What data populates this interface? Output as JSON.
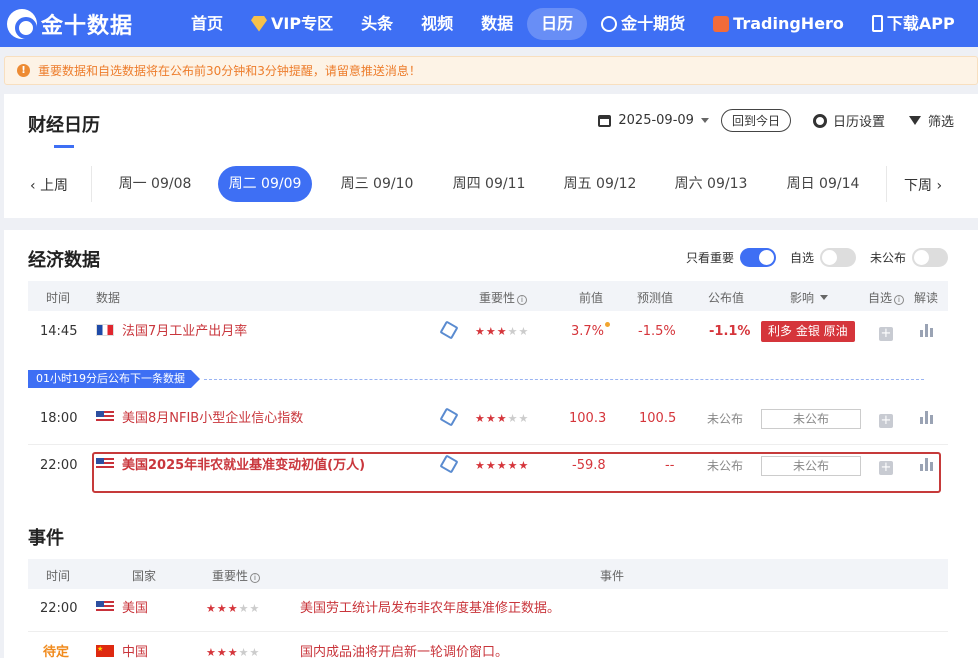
{
  "nav": {
    "logo_text": "金十数据",
    "items": [
      {
        "label": "首页"
      },
      {
        "label": "VIP专区"
      },
      {
        "label": "头条"
      },
      {
        "label": "视频"
      },
      {
        "label": "数据"
      },
      {
        "label": "日历"
      },
      {
        "label": "金十期货"
      },
      {
        "label": "TradingHero"
      },
      {
        "label": "下载APP"
      }
    ],
    "active": "日历"
  },
  "notice": {
    "text": "重要数据和自选数据将在公布前30分钟和3分钟提醒，请留意推送消息！"
  },
  "header": {
    "title": "财经日历",
    "date": "2025-09-09",
    "today_button": "回到今日",
    "settings_label": "日历设置",
    "filter_label": "筛选"
  },
  "week": {
    "prev_label": "上周",
    "next_label": "下周",
    "days": [
      {
        "label": "周一 09/08"
      },
      {
        "label": "周二 09/09"
      },
      {
        "label": "周三 09/10"
      },
      {
        "label": "周四 09/11"
      },
      {
        "label": "周五 09/12"
      },
      {
        "label": "周六 09/13"
      },
      {
        "label": "周日 09/14"
      }
    ],
    "active_day": "周二 09/09"
  },
  "economic": {
    "title": "经济数据",
    "toggles": [
      {
        "label": "只看重要",
        "on": true
      },
      {
        "label": "自选",
        "on": false
      },
      {
        "label": "未公布",
        "on": false
      }
    ],
    "columns": {
      "time": "时间",
      "data": "数据",
      "importance": "重要性",
      "previous": "前值",
      "forecast": "预测值",
      "actual": "公布值",
      "impact": "影响",
      "watch": "自选",
      "analysis": "解读"
    },
    "next_release_banner": "01小时19分后公布下一条数据",
    "rows": [
      {
        "time": "14:45",
        "country_flag": "France",
        "name": "法国7月工业产出月率",
        "stars": 3,
        "previous": "3.7%",
        "forecast": "-1.5%",
        "actual": "-1.1%",
        "impact": "利多 金银 原油",
        "highlight": false
      },
      {
        "time": "18:00",
        "country_flag": "United States",
        "name": "美国8月NFIB小型企业信心指数",
        "stars": 3,
        "previous": "100.3",
        "forecast": "100.5",
        "actual": "未公布",
        "impact": "未公布",
        "highlight": false
      },
      {
        "time": "22:00",
        "country_flag": "United States",
        "name": "美国2025年非农就业基准变动初值(万人)",
        "stars": 5,
        "previous": "-59.8",
        "forecast": "--",
        "actual": "未公布",
        "impact": "未公布",
        "highlight": true
      }
    ]
  },
  "events": {
    "title": "事件",
    "columns": {
      "time": "时间",
      "country": "国家",
      "importance": "重要性",
      "event": "事件"
    },
    "rows": [
      {
        "time": "22:00",
        "country": "美国",
        "stars": 3,
        "event": "美国劳工统计局发布非农年度基准修正数据。"
      },
      {
        "time": "待定",
        "country": "中国",
        "stars": 3,
        "event": "国内成品油将开启新一轮调价窗口。"
      }
    ]
  },
  "colors": {
    "brand_blue": "#3e6ff4",
    "red": "#d5353b",
    "notice_orange": "#ed7d2c"
  }
}
